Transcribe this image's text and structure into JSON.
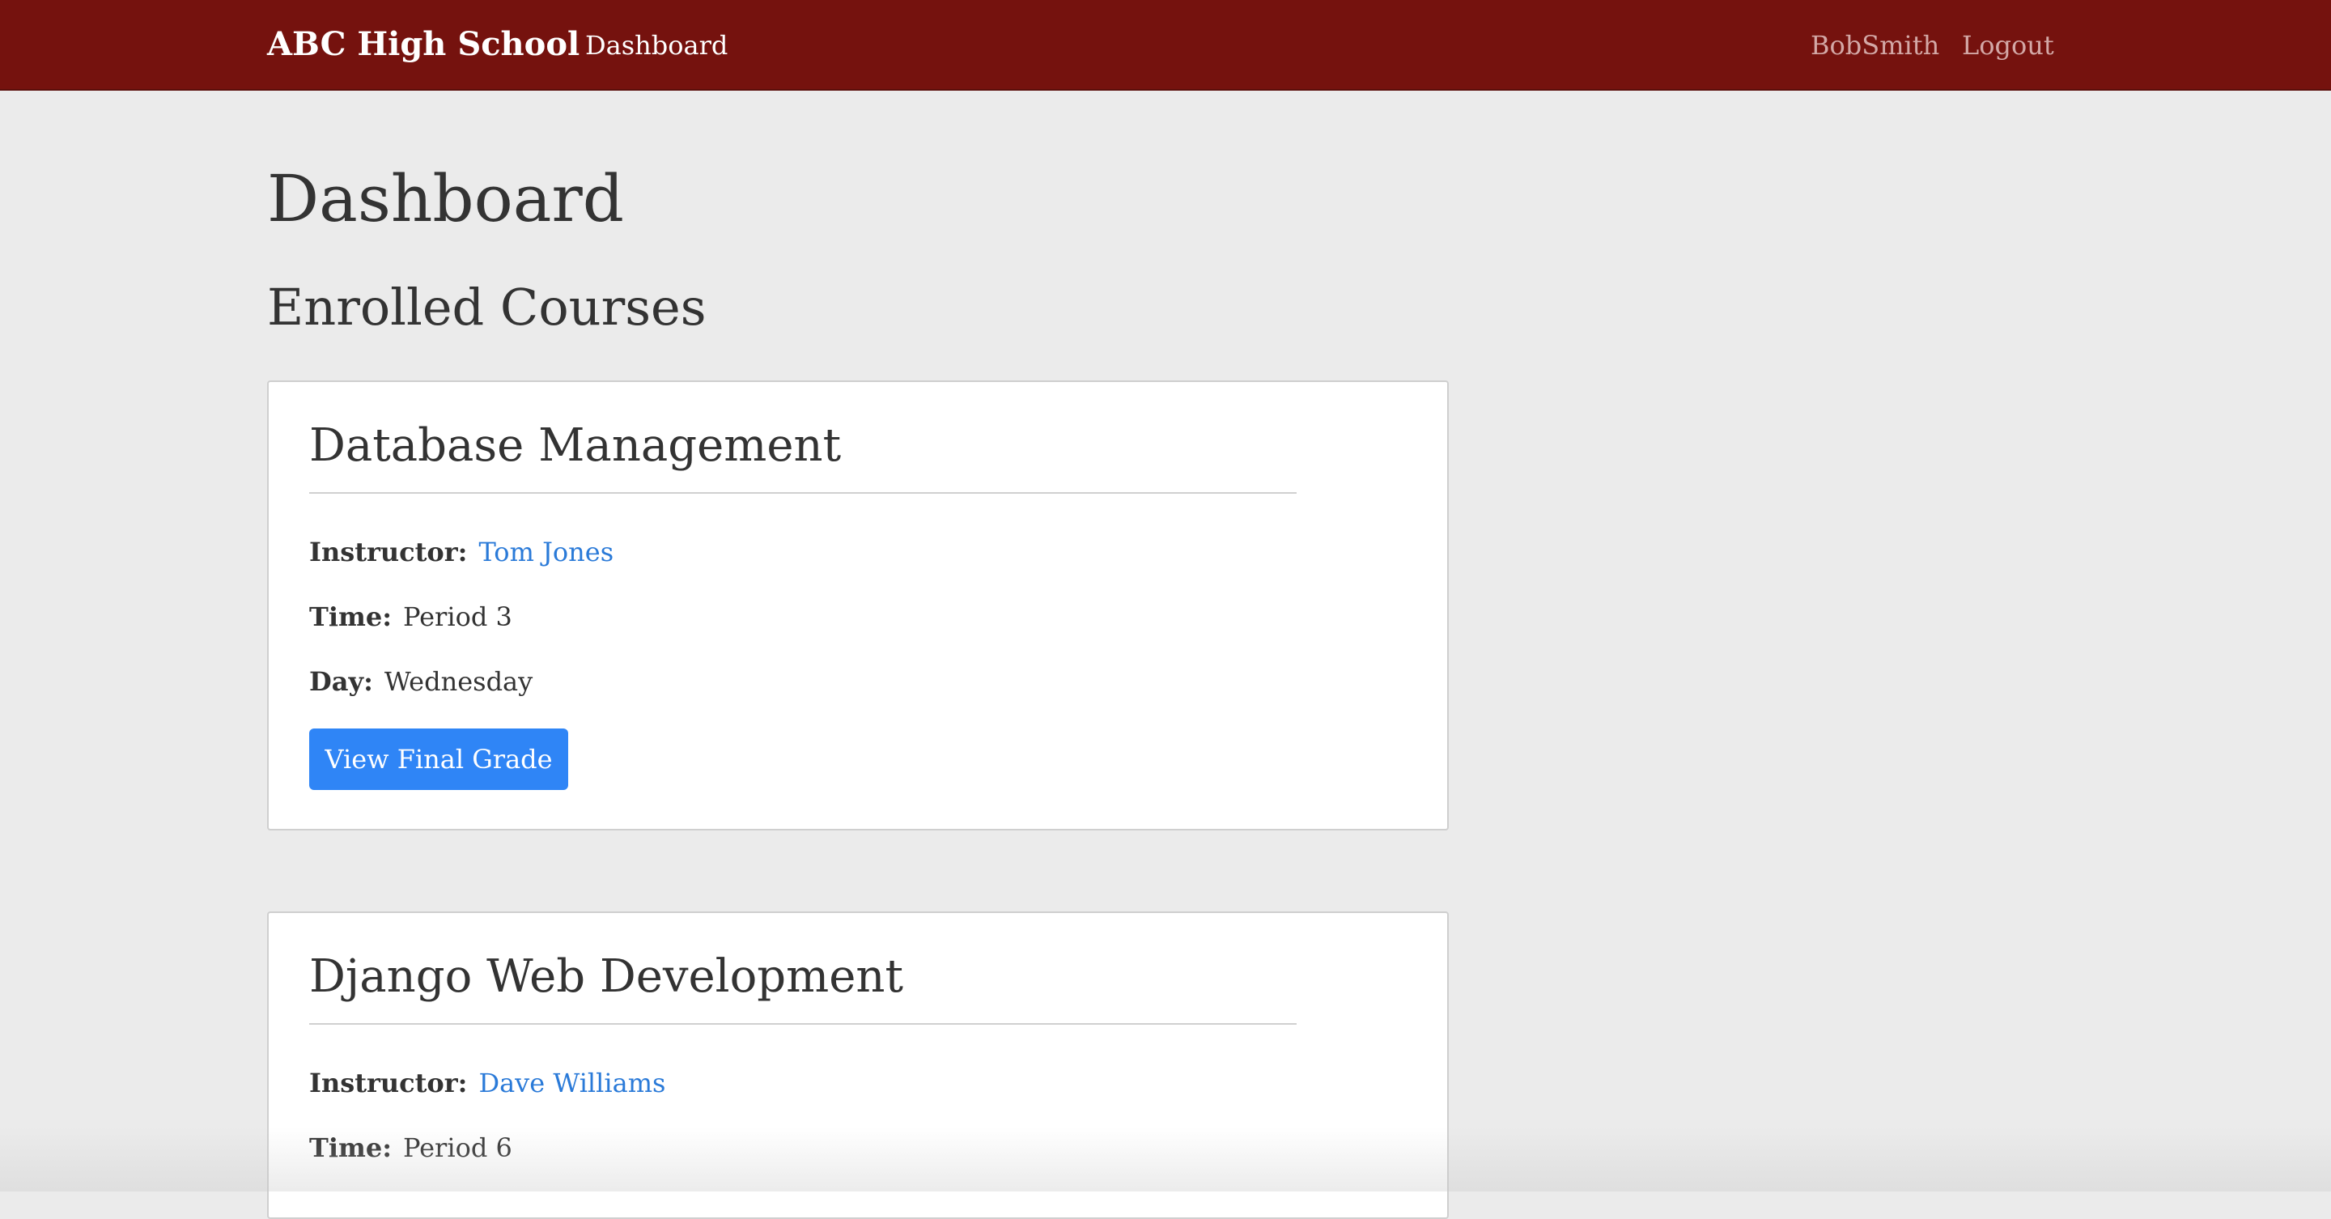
{
  "navbar": {
    "brand": "ABC High School",
    "dashboard_link": "Dashboard",
    "username": "BobSmith",
    "logout_link": "Logout",
    "background_color": "#75120e"
  },
  "page": {
    "title": "Dashboard",
    "section_title": "Enrolled Courses"
  },
  "courses": [
    {
      "title": "Database Management",
      "instructor_label": "Instructor:",
      "instructor": "Tom Jones",
      "time_label": "Time:",
      "time": "Period 3",
      "day_label": "Day:",
      "day": "Wednesday",
      "button_label": "View Final Grade"
    },
    {
      "title": "Django Web Development",
      "instructor_label": "Instructor:",
      "instructor": "Dave Williams",
      "time_label": "Time:",
      "time": "Period 6"
    }
  ],
  "colors": {
    "link": "#2a7ad8",
    "button": "#2f85f6",
    "page_background": "#ebebeb"
  }
}
